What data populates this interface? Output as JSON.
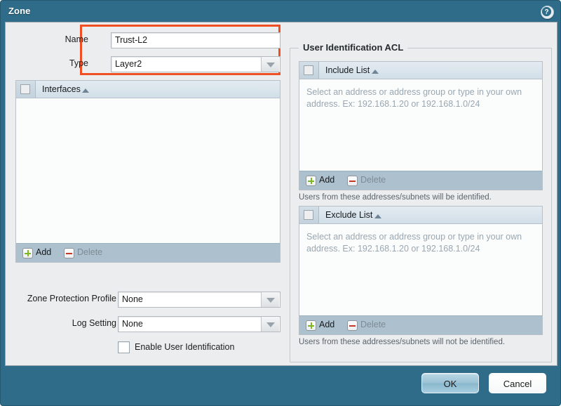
{
  "window": {
    "title": "Zone",
    "help_icon": "help-circle-icon"
  },
  "form": {
    "name_label": "Name",
    "name_value": "Trust-L2",
    "type_label": "Type",
    "type_value": "Layer2",
    "zone_protection_label": "Zone Protection Profile",
    "zone_protection_value": "None",
    "log_setting_label": "Log Setting",
    "log_setting_value": "None",
    "enable_user_id_label": "Enable User Identification",
    "enable_user_id_checked": false
  },
  "interfaces_table": {
    "column_header": "Interfaces",
    "sort_direction": "asc",
    "header_checkbox_checked": false,
    "rows": [],
    "add_label": "Add",
    "delete_label": "Delete",
    "delete_enabled": false
  },
  "user_id_acl": {
    "legend": "User Identification ACL",
    "include": {
      "column_header": "Include List",
      "sort_direction": "asc",
      "header_checkbox_checked": false,
      "placeholder": "Select an address or address group or type in your own\naddress. Ex: 192.168.1.20 or 192.168.1.0/24",
      "add_label": "Add",
      "delete_label": "Delete",
      "delete_enabled": false,
      "helper_text": "Users from these addresses/subnets will be identified."
    },
    "exclude": {
      "column_header": "Exclude List",
      "sort_direction": "asc",
      "header_checkbox_checked": false,
      "placeholder": "Select an address or address group or type in your own\naddress. Ex: 192.168.1.20 or 192.168.1.0/24",
      "add_label": "Add",
      "delete_label": "Delete",
      "delete_enabled": false,
      "helper_text": "Users from these addresses/subnets will not be identified."
    }
  },
  "footer": {
    "ok_label": "OK",
    "cancel_label": "Cancel"
  },
  "colors": {
    "window_chrome": "#2e6c8a",
    "content_bg": "#ebedef",
    "highlight_outline": "#f04f23",
    "table_footer": "#acc0cd",
    "add_icon_green": "#7ab81e",
    "delete_icon_red": "#c0392b"
  }
}
